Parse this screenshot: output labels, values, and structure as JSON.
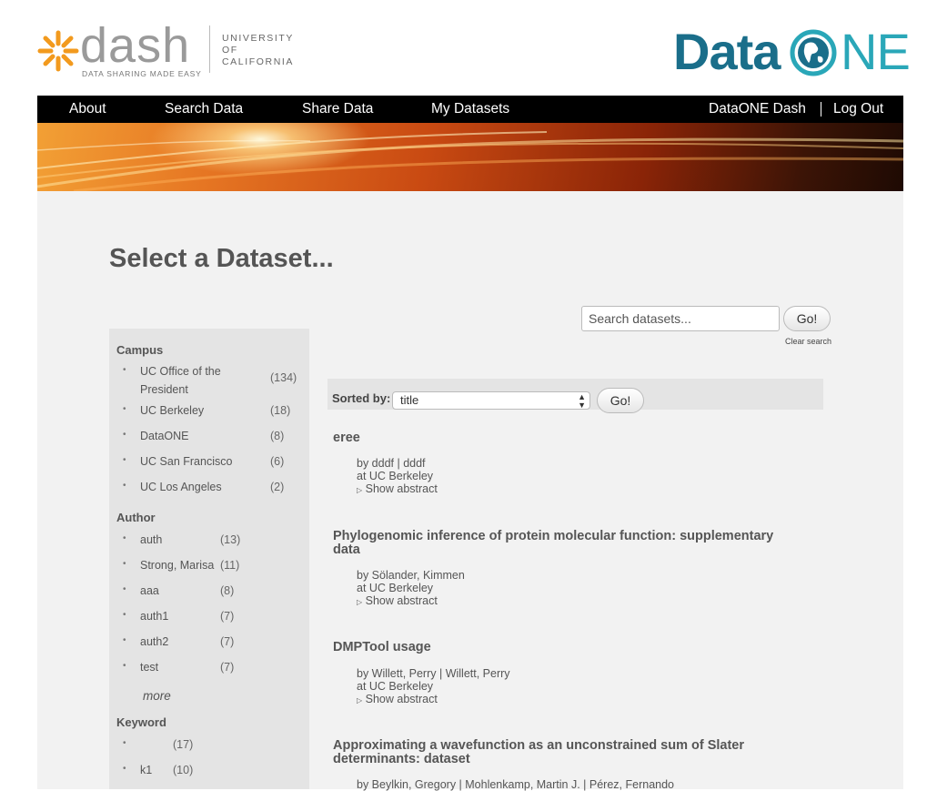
{
  "header": {
    "dash_wordmark": "dash",
    "dash_tagline": "DATA SHARING MADE EASY",
    "uc_line1": "UNIVERSITY",
    "uc_line2": "OF",
    "uc_line3": "CALIFORNIA",
    "dataone_part1": "Data",
    "dataone_part2": "NE"
  },
  "nav": {
    "about": "About",
    "search_data": "Search Data",
    "share_data": "Share Data",
    "my_datasets": "My Datasets",
    "dataone_dash": "DataONE Dash",
    "log_out": "Log Out"
  },
  "page": {
    "title": "Select a Dataset..."
  },
  "search": {
    "placeholder": "Search datasets...",
    "go_label": "Go!",
    "clear_label": "Clear search"
  },
  "sort": {
    "label": "Sorted by:",
    "selected": "title",
    "go_label": "Go!"
  },
  "facets": {
    "campus": {
      "title": "Campus",
      "items": [
        {
          "label_line1": "UC Office of the",
          "label_line2": "President",
          "count": "(134)"
        },
        {
          "label": "UC Berkeley",
          "count": "(18)"
        },
        {
          "label": "DataONE",
          "count": "(8)"
        },
        {
          "label": "UC San Francisco",
          "count": "(6)"
        },
        {
          "label": "UC Los Angeles",
          "count": "(2)"
        }
      ]
    },
    "author": {
      "title": "Author",
      "items": [
        {
          "label": "auth",
          "count": "(13)"
        },
        {
          "label": "Strong, Marisa",
          "count": "(11)"
        },
        {
          "label": "aaa",
          "count": "(8)"
        },
        {
          "label": "auth1",
          "count": "(7)"
        },
        {
          "label": "auth2",
          "count": "(7)"
        },
        {
          "label": "test",
          "count": "(7)"
        }
      ],
      "more_label": "more"
    },
    "keyword": {
      "title": "Keyword",
      "items": [
        {
          "label": "",
          "count": "(17)"
        },
        {
          "label": "k1",
          "count": "(10)"
        }
      ]
    }
  },
  "results": [
    {
      "title": "eree",
      "authors": "by dddf | dddf",
      "campus": "at UC Berkeley",
      "abstract_label": "Show abstract"
    },
    {
      "title_line1": "Phylogenomic inference of protein molecular function: supplementary",
      "title_line2": "data",
      "authors": "by Sölander, Kimmen",
      "campus": "at UC Berkeley",
      "abstract_label": "Show abstract"
    },
    {
      "title": "DMPTool usage",
      "authors": "by Willett, Perry | Willett, Perry",
      "campus": "at UC Berkeley",
      "abstract_label": "Show abstract"
    },
    {
      "title_line1": "Approximating a wavefunction as an unconstrained sum of Slater",
      "title_line2": "determinants: dataset",
      "authors": "by Beylkin, Gregory | Mohlenkamp, Martin J. | Pérez, Fernando"
    }
  ],
  "colors": {
    "dash_orange": "#f29a1e",
    "dataone_dark": "#1a6e8a",
    "dataone_light": "#2aa7b8",
    "navbar": "#000000",
    "content_bg": "#f2f2f2",
    "sidebar_bg": "#e4e4e4"
  }
}
